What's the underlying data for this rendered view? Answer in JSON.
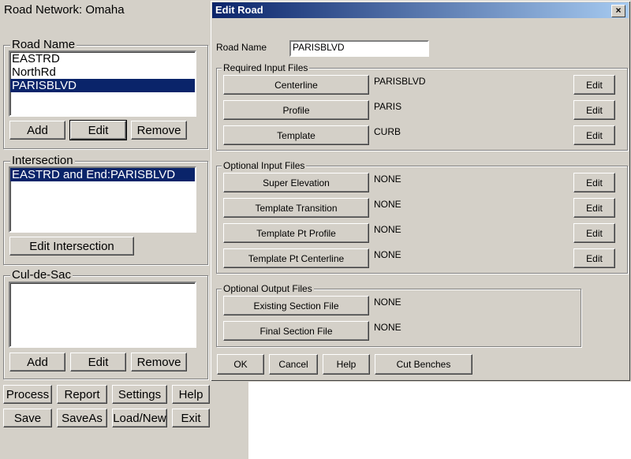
{
  "window": {
    "title": "Road Network: Omaha"
  },
  "road_name_group": {
    "label": "Road Name",
    "items": [
      "EASTRD",
      "NorthRd",
      "PARISBLVD"
    ],
    "selected": "PARISBLVD",
    "add": "Add",
    "edit": "Edit",
    "remove": "Remove"
  },
  "intersection_group": {
    "label": "Intersection",
    "items": [
      "EASTRD and End:PARISBLVD"
    ],
    "edit_intersection": "Edit Intersection"
  },
  "culdesac_group": {
    "label": "Cul-de-Sac",
    "items": [],
    "add": "Add",
    "edit": "Edit",
    "remove": "Remove"
  },
  "bottom_buttons": {
    "process": "Process",
    "report": "Report",
    "settings": "Settings",
    "help": "Help",
    "save": "Save",
    "saveas": "SaveAs",
    "load_new": "Load/New",
    "exit": "Exit"
  },
  "dialog": {
    "title": "Edit Road",
    "close": "×",
    "road_name_label": "Road Name",
    "road_name_value": "PARISBLVD",
    "required": {
      "label": "Required Input Files",
      "rows": [
        {
          "button": "Centerline",
          "value": "PARISBLVD",
          "edit": "Edit"
        },
        {
          "button": "Profile",
          "value": "PARIS",
          "edit": "Edit"
        },
        {
          "button": "Template",
          "value": "CURB",
          "edit": "Edit"
        }
      ]
    },
    "optional_input": {
      "label": "Optional Input Files",
      "rows": [
        {
          "button": "Super Elevation",
          "value": "NONE",
          "edit": "Edit"
        },
        {
          "button": "Template Transition",
          "value": "NONE",
          "edit": "Edit"
        },
        {
          "button": "Template Pt Profile",
          "value": "NONE",
          "edit": "Edit"
        },
        {
          "button": "Template Pt Centerline",
          "value": "NONE",
          "edit": "Edit"
        }
      ]
    },
    "optional_output": {
      "label": "Optional Output Files",
      "rows": [
        {
          "button": "Existing Section File",
          "value": "NONE"
        },
        {
          "button": "Final Section File",
          "value": "NONE"
        }
      ]
    },
    "footer": {
      "ok": "OK",
      "cancel": "Cancel",
      "help": "Help",
      "cut_benches": "Cut Benches"
    }
  }
}
